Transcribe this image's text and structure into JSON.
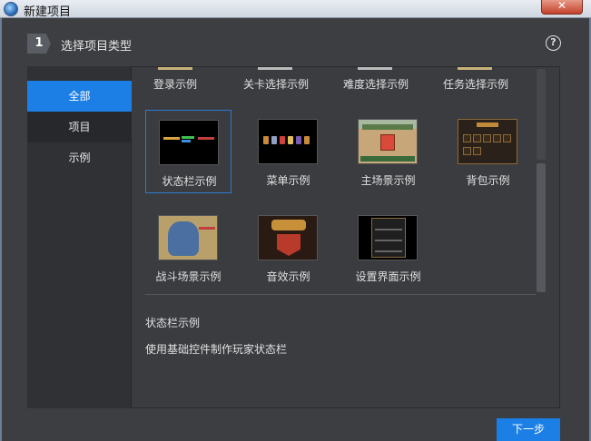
{
  "window": {
    "title": "新建项目",
    "close_label": "✕"
  },
  "header": {
    "step_number": "1",
    "step_title": "选择项目类型",
    "help_icon": "?"
  },
  "sidebar": {
    "items": [
      {
        "label": "全部",
        "active": true
      },
      {
        "label": "项目",
        "active": false
      },
      {
        "label": "示例",
        "active": false
      }
    ]
  },
  "partial_row": [
    {
      "label": "登录示例"
    },
    {
      "label": "关卡选择示例"
    },
    {
      "label": "难度选择示例"
    },
    {
      "label": "任务选择示例"
    }
  ],
  "templates": [
    {
      "label": "状态栏示例",
      "selected": true
    },
    {
      "label": "菜单示例",
      "selected": false
    },
    {
      "label": "主场景示例",
      "selected": false
    },
    {
      "label": "背包示例",
      "selected": false
    },
    {
      "label": "战斗场景示例",
      "selected": false
    },
    {
      "label": "音效示例",
      "selected": false
    },
    {
      "label": "设置界面示例",
      "selected": false
    }
  ],
  "description": {
    "title": "状态栏示例",
    "text": "使用基础控件制作玩家状态栏"
  },
  "footer": {
    "next_label": "下一步"
  },
  "colors": {
    "accent": "#1c7fe6",
    "selected_border": "#2e7ad0"
  }
}
